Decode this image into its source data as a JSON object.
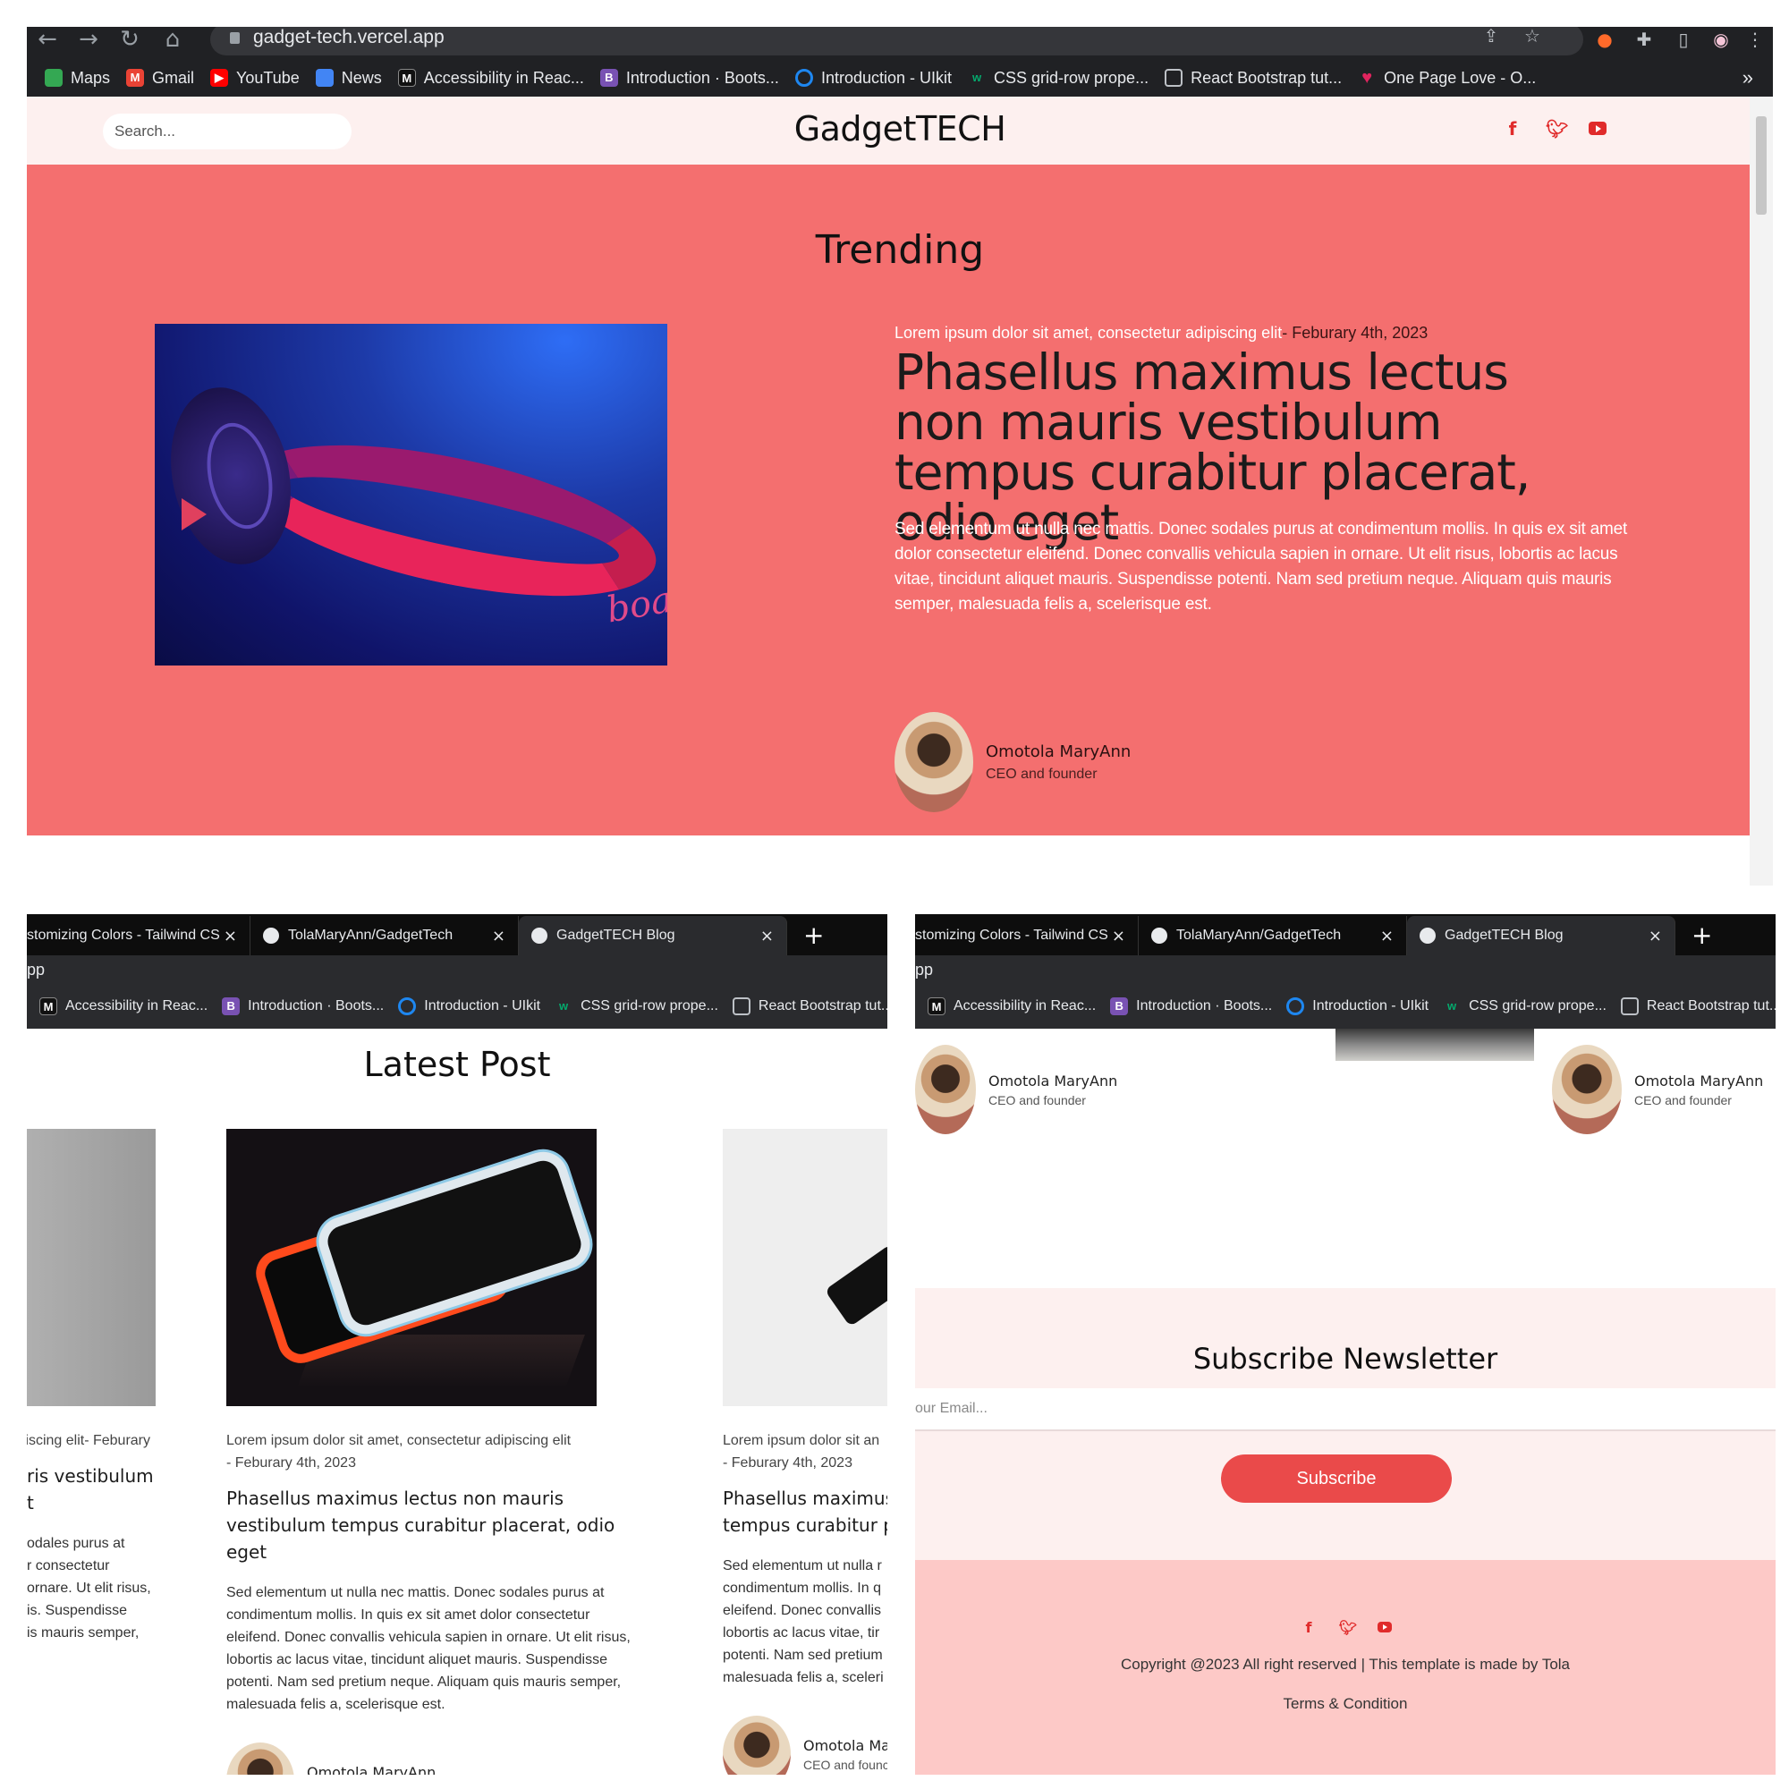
{
  "browser": {
    "url": "gadget-tech.vercel.app",
    "bookmarks": [
      {
        "label": "Maps",
        "icon": "maps-icon",
        "color": "#34a853"
      },
      {
        "label": "Gmail",
        "icon": "gmail-icon",
        "color": "#ea4335"
      },
      {
        "label": "YouTube",
        "icon": "youtube-icon",
        "color": "#ff0000"
      },
      {
        "label": "News",
        "icon": "news-icon",
        "color": "#4285f4"
      },
      {
        "label": "Accessibility in Reac...",
        "icon": "m-icon",
        "color": "#000000"
      },
      {
        "label": "Introduction · Boots...",
        "icon": "bootstrap-icon",
        "color": "#7952b3"
      },
      {
        "label": "Introduction - UIkit",
        "icon": "uikit-icon",
        "color": "#1e87f0"
      },
      {
        "label": "CSS grid-row prope...",
        "icon": "w3-icon",
        "color": "#04aa6d"
      },
      {
        "label": "React Bootstrap tut...",
        "icon": "page-icon",
        "color": "#5f6368"
      },
      {
        "label": "One Page Love - O...",
        "icon": "heart-icon",
        "color": "#e0245e"
      }
    ],
    "more": "»",
    "tabs": [
      {
        "label": "stomizing Colors - Tailwind CS",
        "icon": "tailwind-icon"
      },
      {
        "label": "TolaMaryAnn/GadgetTech",
        "icon": "github-icon"
      },
      {
        "label": "GadgetTECH Blog",
        "icon": "vercel-icon"
      }
    ],
    "tab_close": "×",
    "new_tab": "+",
    "addr_fragment": "pp",
    "small_bookmarks": [
      {
        "label": "Accessibility in Reac...",
        "icon": "m-icon",
        "color": "#000000"
      },
      {
        "label": "Introduction · Boots...",
        "icon": "bootstrap-icon",
        "color": "#7952b3"
      },
      {
        "label": "Introduction - UIkit",
        "icon": "uikit-icon",
        "color": "#1e87f0"
      },
      {
        "label": "CSS grid-row prope...",
        "icon": "w3-icon",
        "color": "#04aa6d"
      },
      {
        "label": "React Bootstrap tut...",
        "icon": "page-icon",
        "color": "#5f6368"
      }
    ]
  },
  "header": {
    "search_placeholder": "Search...",
    "logo": "GadgetTECH",
    "social": [
      "facebook-icon",
      "twitter-icon",
      "youtube-icon"
    ]
  },
  "trending": {
    "title": "Trending",
    "meta": "Lorem ipsum dolor sit amet, consectetur adipiscing elit",
    "date": "- Feburary 4th, 2023",
    "heading": "Phasellus maximus lectus non mauris vestibulum tempus curabitur placerat, odio eget",
    "body": "Sed elementum ut nulla nec mattis. Donec sodales purus at condimentum mollis. In quis ex sit amet dolor consectetur eleifend. Donec convallis vehicula sapien in ornare. Ut elit risus, lobortis ac lacus vitae, tincidunt aliquet mauris. Suspendisse potenti. Nam sed pretium neque. Aliquam quis mauris semper, malesuada felis a, scelerisque est.",
    "image_brand": "boat",
    "author": {
      "name": "Omotola MaryAnn",
      "role": "CEO and founder"
    }
  },
  "latest": {
    "title": "Latest Post",
    "left_peek": {
      "meta": "piscing elit- Feburary",
      "title_l1": "ris vestibulum",
      "title_l2": "t",
      "body": [
        "odales purus at",
        "r consectetur",
        "ornare. Ut elit risus,",
        "is. Suspendisse",
        "is mauris semper,"
      ]
    },
    "post": {
      "meta_l1": "Lorem ipsum dolor sit amet, consectetur adipiscing elit",
      "meta_l2": "- Feburary 4th, 2023",
      "title": "Phasellus maximus lectus non mauris vestibulum tempus curabitur placerat, odio eget",
      "body": "Sed elementum ut nulla nec mattis. Donec sodales purus at condimentum mollis. In quis ex sit amet dolor consectetur eleifend. Donec convallis vehicula sapien in ornare. Ut elit risus, lobortis ac lacus vitae, tincidunt aliquet mauris. Suspendisse potenti. Nam sed pretium neque. Aliquam quis mauris semper, malesuada felis a, scelerisque est.",
      "author": {
        "name": "Omotola MaryAnn",
        "role": "CEO and founder"
      }
    },
    "right_peek": {
      "meta_l1": "Lorem ipsum dolor sit an",
      "meta_l2": "- Feburary 4th, 2023",
      "title_l1": "Phasellus maximus",
      "title_l2": "tempus curabitur pl",
      "body": [
        "Sed elementum ut nulla r",
        "condimentum mollis. In q",
        "eleifend. Donec convallis",
        "lobortis ac lacus vitae, tir",
        "potenti. Nam sed pretium",
        "malesuada felis a, sceleri"
      ],
      "author": {
        "name": "Omotola Mar",
        "role": "CEO and founc"
      }
    }
  },
  "right_panel": {
    "authors": [
      {
        "name": "Omotola MaryAnn",
        "role": "CEO and founder"
      },
      {
        "name": "Omotola MaryAnn",
        "role": "CEO and founder"
      }
    ],
    "newsletter": {
      "title": "Subscribe Newsletter",
      "email_placeholder": "our Email...",
      "button": "Subscribe"
    },
    "footer": {
      "social": [
        "facebook-icon",
        "twitter-icon",
        "youtube-icon"
      ],
      "copyright": "Copyright @2023 All right reserved | This template is made by Tola",
      "terms": "Terms & Condition"
    }
  },
  "colors": {
    "hero_bg": "#f46f6f",
    "header_bg": "#fdf0ef",
    "accent": "#e02b2b",
    "button": "#ea4a4a",
    "footer_bg": "#fdc9c7"
  }
}
